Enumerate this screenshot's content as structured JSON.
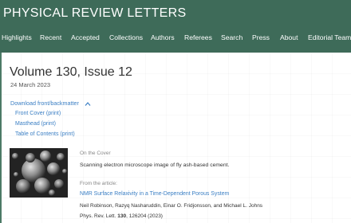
{
  "header": {
    "logo": "PHYSICAL REVIEW LETTERS",
    "nav": [
      "Highlights",
      "Recent",
      "Accepted",
      "Collections",
      "Authors",
      "Referees",
      "Search",
      "Press",
      "About",
      "Editorial Team"
    ]
  },
  "issue": {
    "title": "Volume 130, Issue 12",
    "date": "24 March 2023"
  },
  "downloads": {
    "toggle_label": "Download front/backmatter",
    "toggle_icon": "chevron-up-icon",
    "items": [
      "Front Cover (print)",
      "Masthead (print)",
      "Table of Contents (print)"
    ]
  },
  "cover": {
    "section_label": "On the Cover",
    "description": "Scanning electron microscope image of fly ash-based cement.",
    "article_label": "From the article:",
    "article_title": "NMR Surface Relaxivity in a Time-Dependent Porous System",
    "authors": "Neil Robinson, Razyq Nasharuddin, Einar O. Fridjonsson, and Michael L. Johns",
    "citation_prefix": "Phys. Rev. Lett. ",
    "citation_volume": "130",
    "citation_suffix": ", 126204 (2023)"
  },
  "colors": {
    "header_bg": "#3e6b59",
    "link": "#3b7fc4",
    "text": "#333333",
    "muted": "#888888"
  }
}
